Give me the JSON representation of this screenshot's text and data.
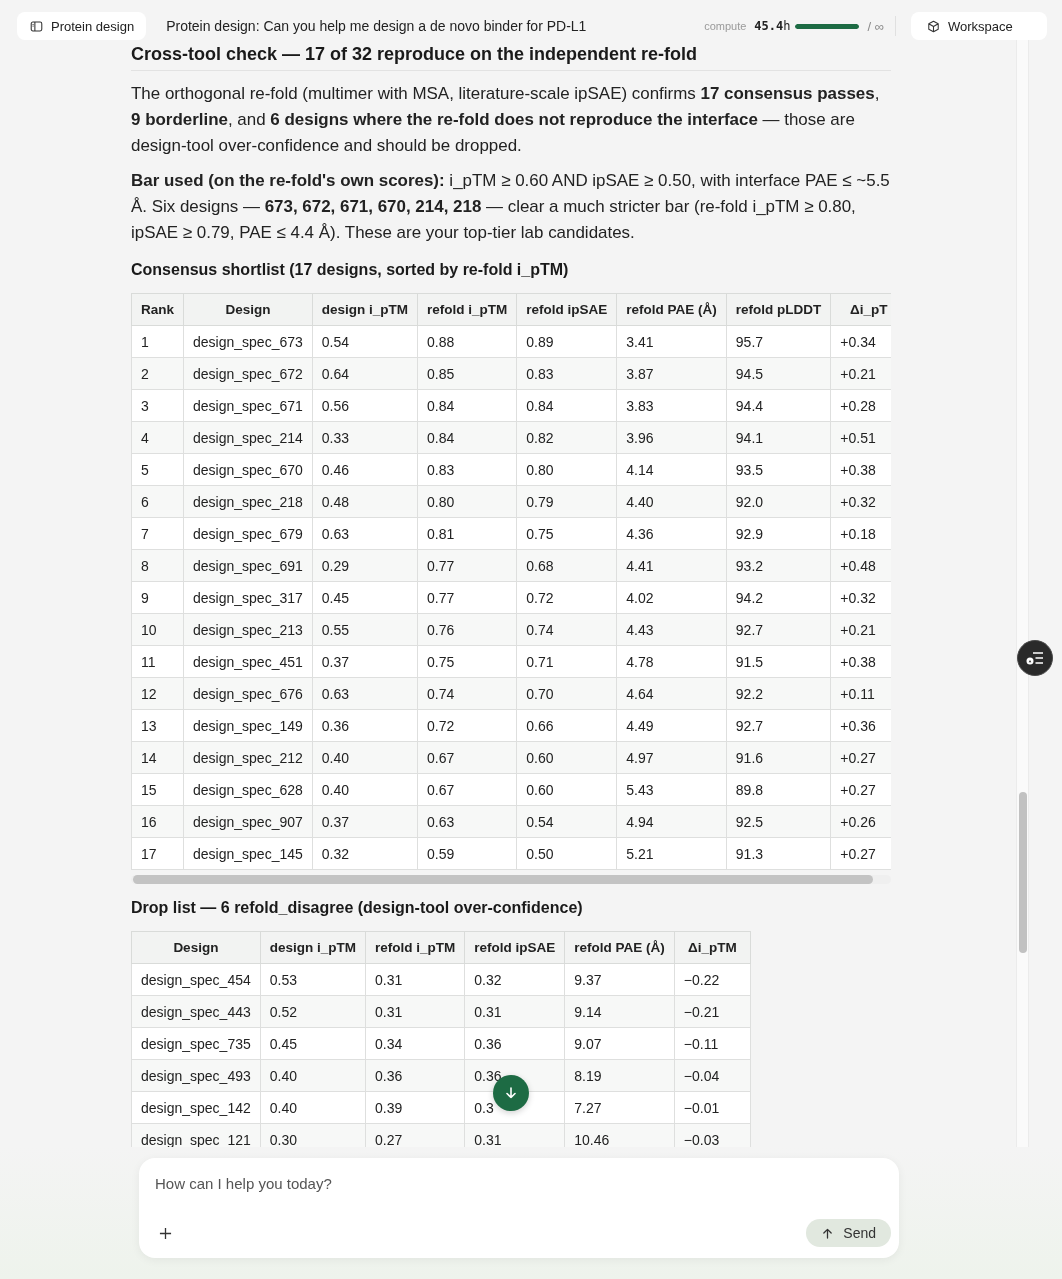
{
  "topbar": {
    "project_button": "Protein design",
    "title": "Protein design: Can you help me design a de novo binder for PD-L1",
    "compute": {
      "label": "compute",
      "value": "**45.4**h",
      "level": 1,
      "limit": "/ ∞"
    },
    "workspace_button": "Workspace"
  },
  "message": {
    "heading": "Cross-tool check — 17 of 32 reproduce on the independent re-fold",
    "paragraphs": [
      "The orthogonal re-fold (multimer with MSA, literature-scale ipSAE) confirms **17 consensus passes**, **9 borderline**, and **6 designs where the re-fold does not reproduce the interface** — those are design-tool over-confidence and should be dropped.",
      "**Bar used (on the re-fold's own scores):** i_pTM ≥ 0.60 AND ipSAE ≥ 0.50, with interface PAE ≤ ~5.5 Å. Six designs — **673, 672, 671, 670, 214, 218** — clear a much stricter bar (re-fold i_pTM ≥ 0.80, ipSAE ≥ 0.79, PAE ≤ 4.4 Å). These are your top-tier lab candidates."
    ],
    "tables": [
      {
        "title": "Consensus shortlist (17 designs, sorted by re-fold i_pTM)",
        "columns": [
          "Rank",
          "Design",
          "design i_pTM",
          "refold i_pTM",
          "refold ipSAE",
          "refold PAE (Å)",
          "refold pLDDT",
          "Δi_pT"
        ],
        "rows": [
          [
            "1",
            "design_spec_673",
            "0.54",
            "0.88",
            "0.89",
            "3.41",
            "95.7",
            "+0.34"
          ],
          [
            "2",
            "design_spec_672",
            "0.64",
            "0.85",
            "0.83",
            "3.87",
            "94.5",
            "+0.21"
          ],
          [
            "3",
            "design_spec_671",
            "0.56",
            "0.84",
            "0.84",
            "3.83",
            "94.4",
            "+0.28"
          ],
          [
            "4",
            "design_spec_214",
            "0.33",
            "0.84",
            "0.82",
            "3.96",
            "94.1",
            "+0.51"
          ],
          [
            "5",
            "design_spec_670",
            "0.46",
            "0.83",
            "0.80",
            "4.14",
            "93.5",
            "+0.38"
          ],
          [
            "6",
            "design_spec_218",
            "0.48",
            "0.80",
            "0.79",
            "4.40",
            "92.0",
            "+0.32"
          ],
          [
            "7",
            "design_spec_679",
            "0.63",
            "0.81",
            "0.75",
            "4.36",
            "92.9",
            "+0.18"
          ],
          [
            "8",
            "design_spec_691",
            "0.29",
            "0.77",
            "0.68",
            "4.41",
            "93.2",
            "+0.48"
          ],
          [
            "9",
            "design_spec_317",
            "0.45",
            "0.77",
            "0.72",
            "4.02",
            "94.2",
            "+0.32"
          ],
          [
            "10",
            "design_spec_213",
            "0.55",
            "0.76",
            "0.74",
            "4.43",
            "92.7",
            "+0.21"
          ],
          [
            "11",
            "design_spec_451",
            "0.37",
            "0.75",
            "0.71",
            "4.78",
            "91.5",
            "+0.38"
          ],
          [
            "12",
            "design_spec_676",
            "0.63",
            "0.74",
            "0.70",
            "4.64",
            "92.2",
            "+0.11"
          ],
          [
            "13",
            "design_spec_149",
            "0.36",
            "0.72",
            "0.66",
            "4.49",
            "92.7",
            "+0.36"
          ],
          [
            "14",
            "design_spec_212",
            "0.40",
            "0.67",
            "0.60",
            "4.97",
            "91.6",
            "+0.27"
          ],
          [
            "15",
            "design_spec_628",
            "0.40",
            "0.67",
            "0.60",
            "5.43",
            "89.8",
            "+0.27"
          ],
          [
            "16",
            "design_spec_907",
            "0.37",
            "0.63",
            "0.54",
            "4.94",
            "92.5",
            "+0.26"
          ],
          [
            "17",
            "design_spec_145",
            "0.32",
            "0.59",
            "0.50",
            "5.21",
            "91.3",
            "+0.27"
          ]
        ]
      },
      {
        "title": "Drop list — 6 refold_disagree (design-tool over-confidence)",
        "columns": [
          "Design",
          "design i_pTM",
          "refold i_pTM",
          "refold ipSAE",
          "refold PAE (Å)",
          "Δi_pTM"
        ],
        "rows": [
          [
            "design_spec_454",
            "0.53",
            "0.31",
            "0.32",
            "9.37",
            "−0.22"
          ],
          [
            "design_spec_443",
            "0.52",
            "0.31",
            "0.31",
            "9.14",
            "−0.21"
          ],
          [
            "design_spec_735",
            "0.45",
            "0.34",
            "0.36",
            "9.07",
            "−0.11"
          ],
          [
            "design_spec_493",
            "0.40",
            "0.36",
            "0.36",
            "8.19",
            "−0.04"
          ],
          [
            "design_spec_142",
            "0.40",
            "0.39",
            "0.3",
            "7.27",
            "−0.01"
          ],
          [
            "design_spec_121",
            "0.30",
            "0.27",
            "0.31",
            "10.46",
            "−0.03"
          ]
        ]
      }
    ]
  },
  "composer": {
    "placeholder": "How can I help you today?",
    "send_button": "Send"
  }
}
